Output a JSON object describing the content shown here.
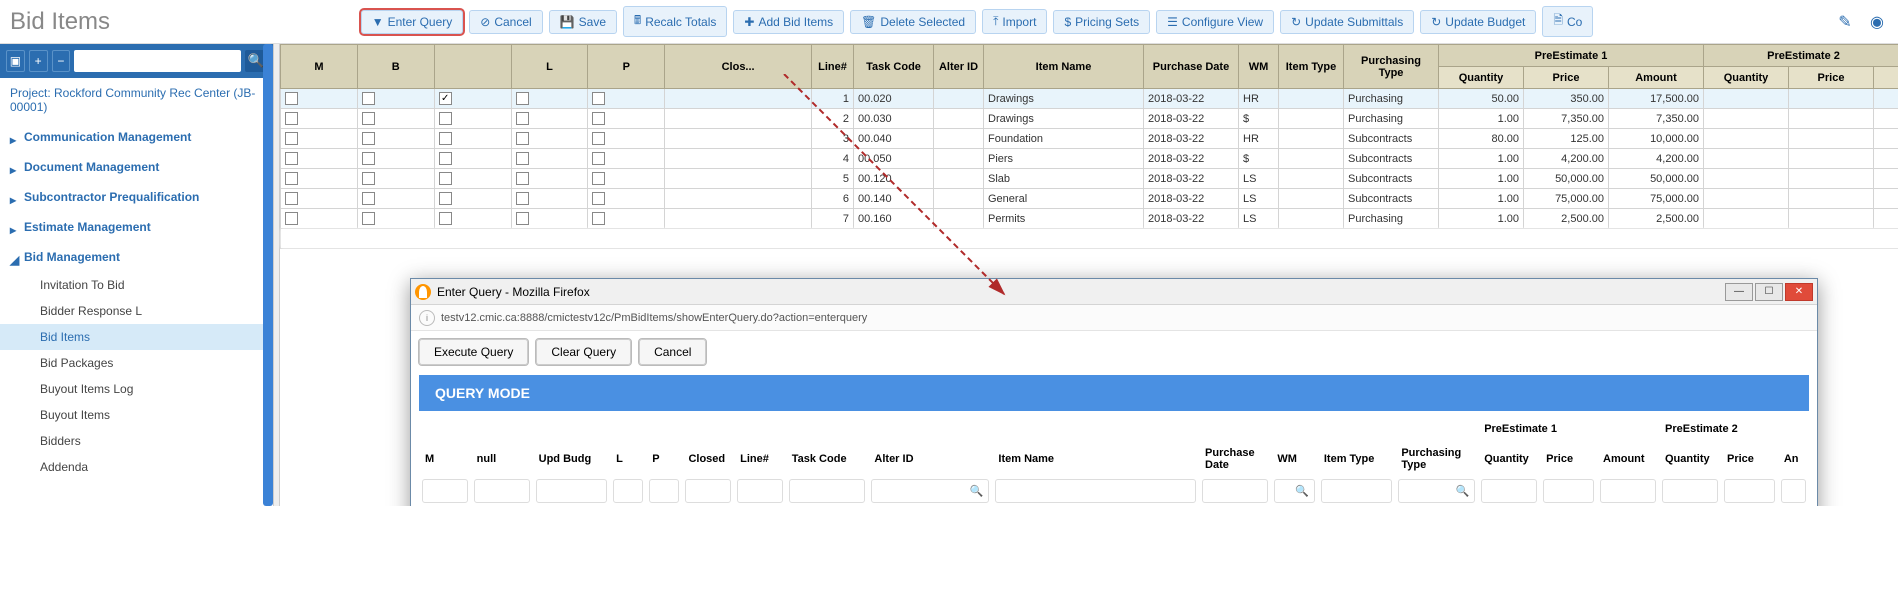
{
  "page_title": "Bid Items",
  "toolbar": {
    "enter_query": "Enter Query",
    "cancel": "Cancel",
    "save": "Save",
    "recalc_totals": "Recalc Totals",
    "add_bid_items": "Add Bid Items",
    "delete_selected": "Delete Selected",
    "import": "Import",
    "pricing_sets": "Pricing Sets",
    "configure_view": "Configure View",
    "update_submittals": "Update Submittals",
    "update_budget": "Update Budget",
    "co": "Co"
  },
  "sidebar": {
    "project_label": "Project: Rockford Community Rec Center (JB-00001)",
    "items": [
      {
        "label": "Communication Management",
        "expanded": false
      },
      {
        "label": "Document Management",
        "expanded": false
      },
      {
        "label": "Subcontractor Prequalification",
        "expanded": false
      },
      {
        "label": "Estimate Management",
        "expanded": false
      },
      {
        "label": "Bid Management",
        "expanded": true
      }
    ],
    "bid_children": [
      {
        "label": "Invitation To Bid"
      },
      {
        "label": "Bidder Response L"
      },
      {
        "label": "Bid Items"
      },
      {
        "label": "Bid Packages"
      },
      {
        "label": "Buyout Items Log"
      },
      {
        "label": "Buyout Items"
      },
      {
        "label": "Bidders"
      },
      {
        "label": "Addenda"
      }
    ]
  },
  "grid": {
    "headers": {
      "m": "M",
      "b": "B",
      "blank": "",
      "l": "L",
      "p": "P",
      "clos": "Clos...",
      "line": "Line#",
      "task_code": "Task Code",
      "alter_id": "Alter ID",
      "item_name": "Item Name",
      "purchase_date": "Purchase Date",
      "wm": "WM",
      "item_type": "Item Type",
      "purchasing_type": "Purchasing Type",
      "pre1": "PreEstimate 1",
      "pre2": "PreEstimate 2",
      "quantity": "Quantity",
      "price": "Price",
      "amount": "Amount"
    },
    "rows": [
      {
        "sel": true,
        "line": "1",
        "task": "00.020",
        "item": "Drawings",
        "date": "2018-03-22",
        "wm": "HR",
        "ptype": "Purchasing",
        "qty": "50.00",
        "price": "350.00",
        "amt": "17,500.00"
      },
      {
        "sel": false,
        "line": "2",
        "task": "00.030",
        "item": "Drawings",
        "date": "2018-03-22",
        "wm": "$",
        "ptype": "Purchasing",
        "qty": "1.00",
        "price": "7,350.00",
        "amt": "7,350.00"
      },
      {
        "sel": false,
        "line": "3",
        "task": "00.040",
        "item": "Foundation",
        "date": "2018-03-22",
        "wm": "HR",
        "ptype": "Subcontracts",
        "qty": "80.00",
        "price": "125.00",
        "amt": "10,000.00"
      },
      {
        "sel": false,
        "line": "4",
        "task": "00.050",
        "item": "Piers",
        "date": "2018-03-22",
        "wm": "$",
        "ptype": "Subcontracts",
        "qty": "1.00",
        "price": "4,200.00",
        "amt": "4,200.00"
      },
      {
        "sel": false,
        "line": "5",
        "task": "00.120",
        "item": "Slab",
        "date": "2018-03-22",
        "wm": "LS",
        "ptype": "Subcontracts",
        "qty": "1.00",
        "price": "50,000.00",
        "amt": "50,000.00"
      },
      {
        "sel": false,
        "line": "6",
        "task": "00.140",
        "item": "General",
        "date": "2018-03-22",
        "wm": "LS",
        "ptype": "Subcontracts",
        "qty": "1.00",
        "price": "75,000.00",
        "amt": "75,000.00"
      },
      {
        "sel": false,
        "line": "7",
        "task": "00.160",
        "item": "Permits",
        "date": "2018-03-22",
        "wm": "LS",
        "ptype": "Purchasing",
        "qty": "1.00",
        "price": "2,500.00",
        "amt": "2,500.00"
      }
    ]
  },
  "popup": {
    "window_title": "Enter Query - Mozilla Firefox",
    "url": "testv12.cmic.ca:8888/cmictestv12c/PmBidItems/showEnterQuery.do?action=enterquery",
    "buttons": {
      "execute": "Execute Query",
      "clear": "Clear Query",
      "cancel": "Cancel"
    },
    "mode_label": "QUERY MODE",
    "headers": {
      "m": "M",
      "null": "null",
      "upd_budg": "Upd Budg",
      "l": "L",
      "p": "P",
      "closed": "Closed",
      "line": "Line#",
      "task_code": "Task Code",
      "alter_id": "Alter ID",
      "item_name": "Item Name",
      "purchase_date": "Purchase Date",
      "wm": "WM",
      "item_type": "Item Type",
      "purchasing_type": "Purchasing Type",
      "pre1": "PreEstimate 1",
      "pre2": "PreEstimate 2",
      "quantity": "Quantity",
      "price": "Price",
      "amount": "Amount",
      "an": "An"
    }
  }
}
